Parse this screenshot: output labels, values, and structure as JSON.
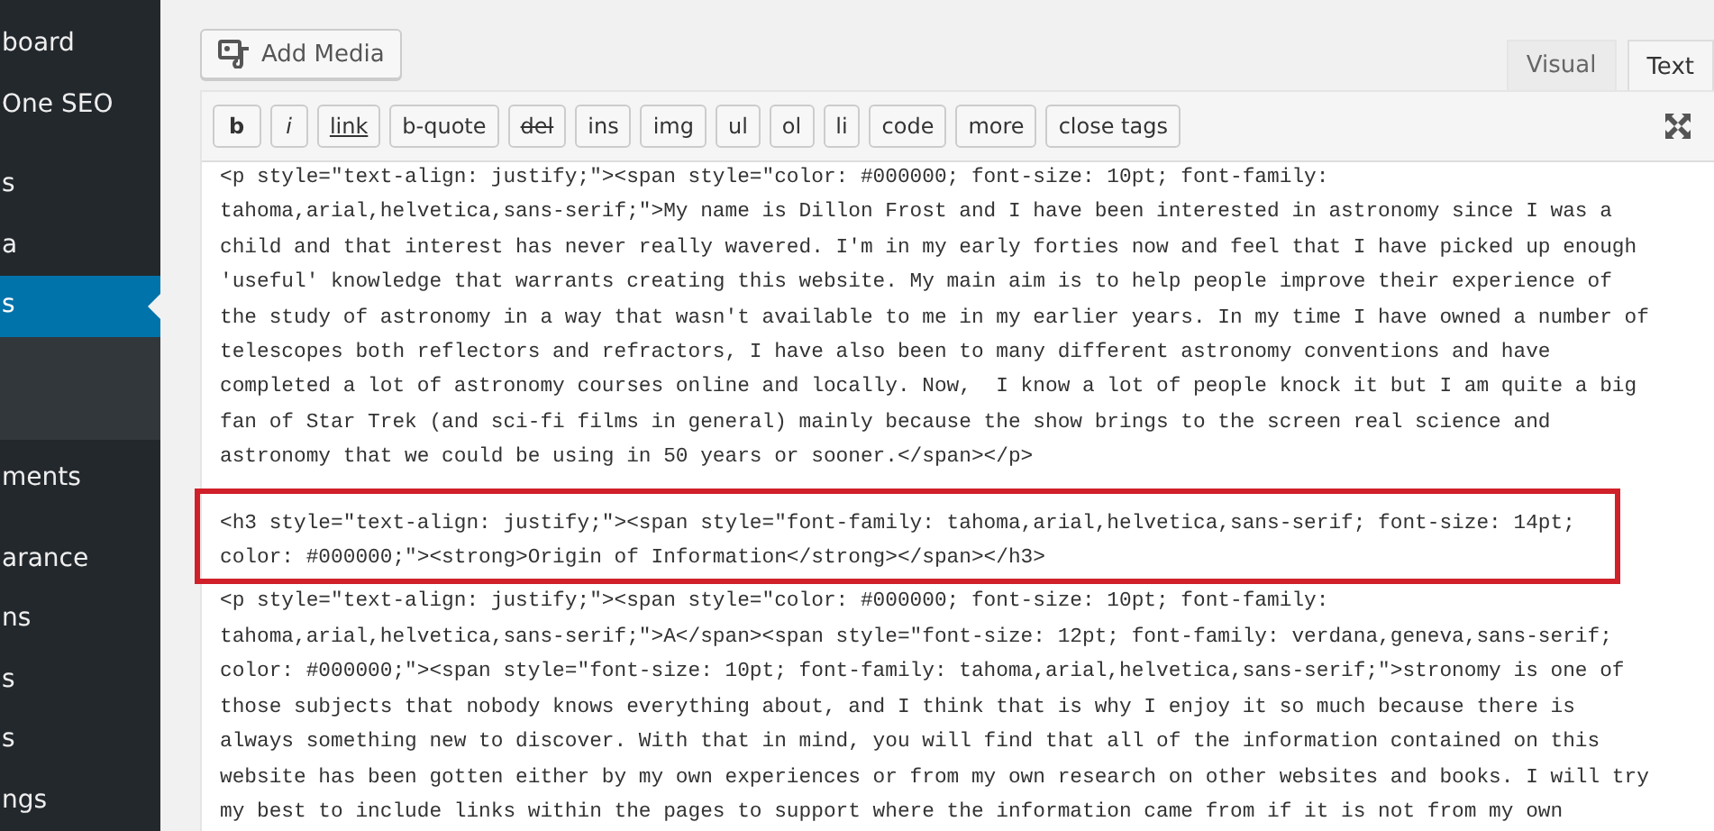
{
  "sidebar": {
    "items": [
      {
        "label": "board",
        "selected": false
      },
      {
        "label": "One SEO",
        "selected": false
      },
      {
        "label": "s",
        "selected": false
      },
      {
        "label": "a",
        "selected": false
      },
      {
        "label": "s",
        "selected": true
      },
      {
        "label": "ments",
        "selected": false
      },
      {
        "label": "arance",
        "selected": false
      },
      {
        "label": "ns",
        "selected": false
      },
      {
        "label": "s",
        "selected": false
      },
      {
        "label": "s",
        "selected": false
      },
      {
        "label": "ngs",
        "selected": false
      }
    ]
  },
  "editor": {
    "add_media": "Add Media",
    "tabs": [
      {
        "label": "Visual",
        "selected": false
      },
      {
        "label": "Text",
        "selected": true
      }
    ],
    "toolbar": [
      {
        "label": "b",
        "kind": "bold"
      },
      {
        "label": "i",
        "kind": "italic"
      },
      {
        "label": "link",
        "kind": "link"
      },
      {
        "label": "b-quote",
        "kind": "plain"
      },
      {
        "label": "del",
        "kind": "strike"
      },
      {
        "label": "ins",
        "kind": "plain"
      },
      {
        "label": "img",
        "kind": "plain"
      },
      {
        "label": "ul",
        "kind": "plain"
      },
      {
        "label": "ol",
        "kind": "plain"
      },
      {
        "label": "li",
        "kind": "plain"
      },
      {
        "label": "code",
        "kind": "plain"
      },
      {
        "label": "more",
        "kind": "plain"
      },
      {
        "label": "close tags",
        "kind": "plain"
      }
    ],
    "blocks": [
      {
        "highlighted": false,
        "lines": [
          "<p style=\"text-align: justify;\"><span style=\"color: #000000; font-size: 10pt; font-family:",
          "tahoma,arial,helvetica,sans-serif;\">My name is Dillon Frost and I have been interested in astronomy since I was a",
          "child and that interest has never really wavered. I'm in my early forties now and feel that I have picked up enough",
          "'useful' knowledge that warrants creating this website. My main aim is to help people improve their experience of",
          "the study of astronomy in a way that wasn't available to me in my earlier years. In my time I have owned a number of",
          "telescopes both reflectors and refractors, I have also been to many different astronomy conventions and have",
          "completed a lot of astronomy courses online and locally. Now,  I know a lot of people knock it but I am quite a big",
          "fan of Star Trek (and sci-fi films in general) mainly because the show brings to the screen real science and",
          "astronomy that we could be using in 50 years or sooner.</span></p>"
        ]
      },
      {
        "highlighted": true,
        "lines": [
          "<h3 style=\"text-align: justify;\"><span style=\"font-family: tahoma,arial,helvetica,sans-serif; font-size: 14pt;",
          "color: #000000;\"><strong>Origin of Information</strong></span></h3>"
        ]
      },
      {
        "highlighted": false,
        "lines": [
          "<p style=\"text-align: justify;\"><span style=\"color: #000000; font-size: 10pt; font-family:",
          "tahoma,arial,helvetica,sans-serif;\">A</span><span style=\"font-size: 12pt; font-family: verdana,geneva,sans-serif;",
          "color: #000000;\"><span style=\"font-size: 10pt; font-family: tahoma,arial,helvetica,sans-serif;\">stronomy is one of",
          "those subjects that nobody knows everything about, and I think that is why I enjoy it so much because there is",
          "always something new to discover. With that in mind, you will find that all of the information contained on this",
          "website has been gotten either by my own experiences or from my own research on other websites and books. I will try",
          "my best to include links within the pages to support where the information came from if it is not from my own"
        ]
      }
    ]
  }
}
